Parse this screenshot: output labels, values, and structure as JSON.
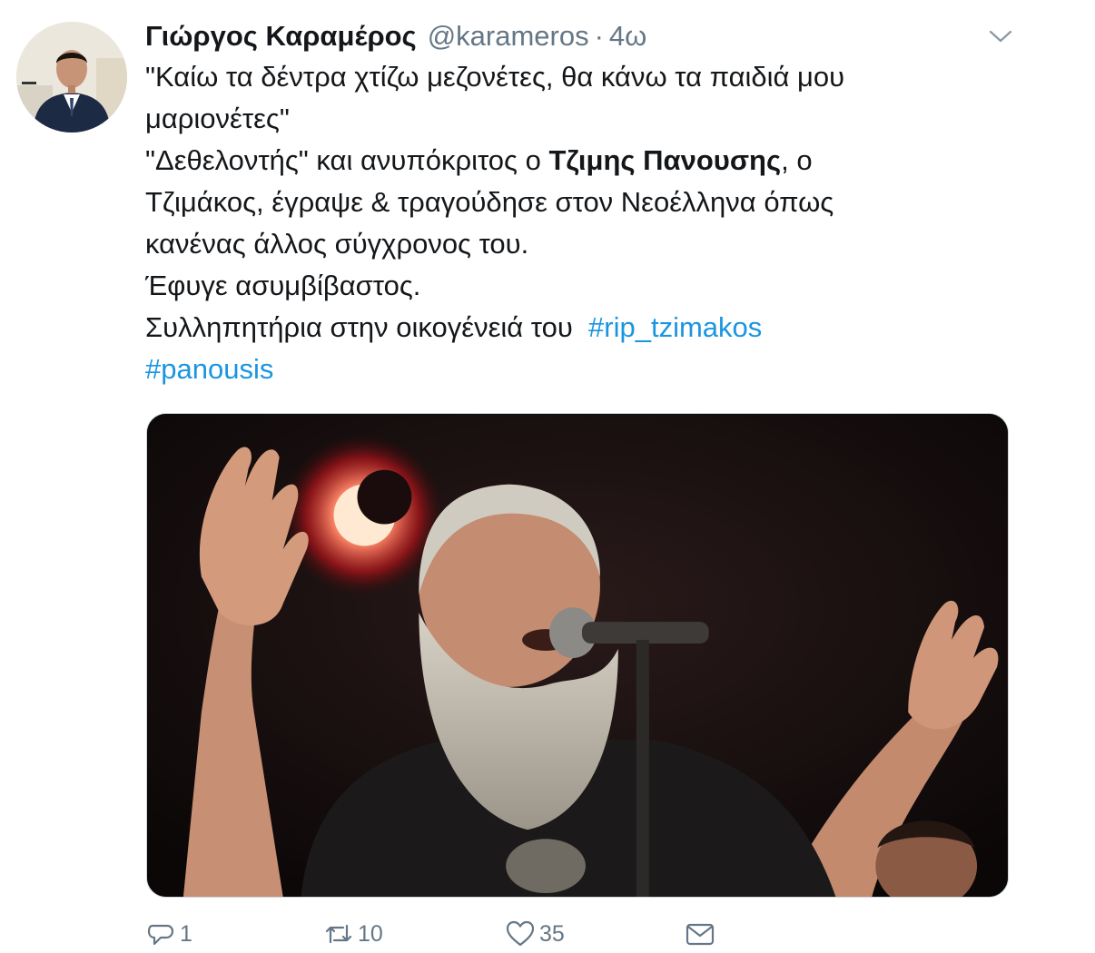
{
  "author": {
    "name": "Γιώργος Καραμέρος",
    "handle": "@karameros",
    "separator": "·",
    "time": "4ω"
  },
  "icons": {
    "menu": "chevron-down-icon",
    "reply": "reply-icon",
    "retweet": "retweet-icon",
    "like": "heart-icon",
    "message": "envelope-icon"
  },
  "tweet": {
    "line1": "\"Καίω τα δέντρα χτίζω μεζονέτες, θα κάνω τα παιδιά μου",
    "line2": "μαριονέτες\"",
    "line3_pre": "\"Δεθελοντής\" και ανυπόκριτος ο ",
    "line3_bold": "Τζιμης Πανουσης",
    "line3_post": ", ο",
    "line4": "Τζιμάκος, έγραψε & τραγούδησε στον Νεοέλληνα όπως",
    "line5": "κανένας άλλος σύγχρονος του.",
    "line6": "Έφυγε ασυμβίβαστος.",
    "line7_pre": "Συλληπητήρια στην οικογένειά του  ",
    "hashtag1": "#rip_tzimakos",
    "hashtag2": "#panousis"
  },
  "stats": {
    "replies": "1",
    "retweets": "10",
    "likes": "35"
  },
  "colors": {
    "link": "#1b95e0",
    "muted": "#657786",
    "text": "#14171a",
    "border": "#ccd6dd"
  }
}
